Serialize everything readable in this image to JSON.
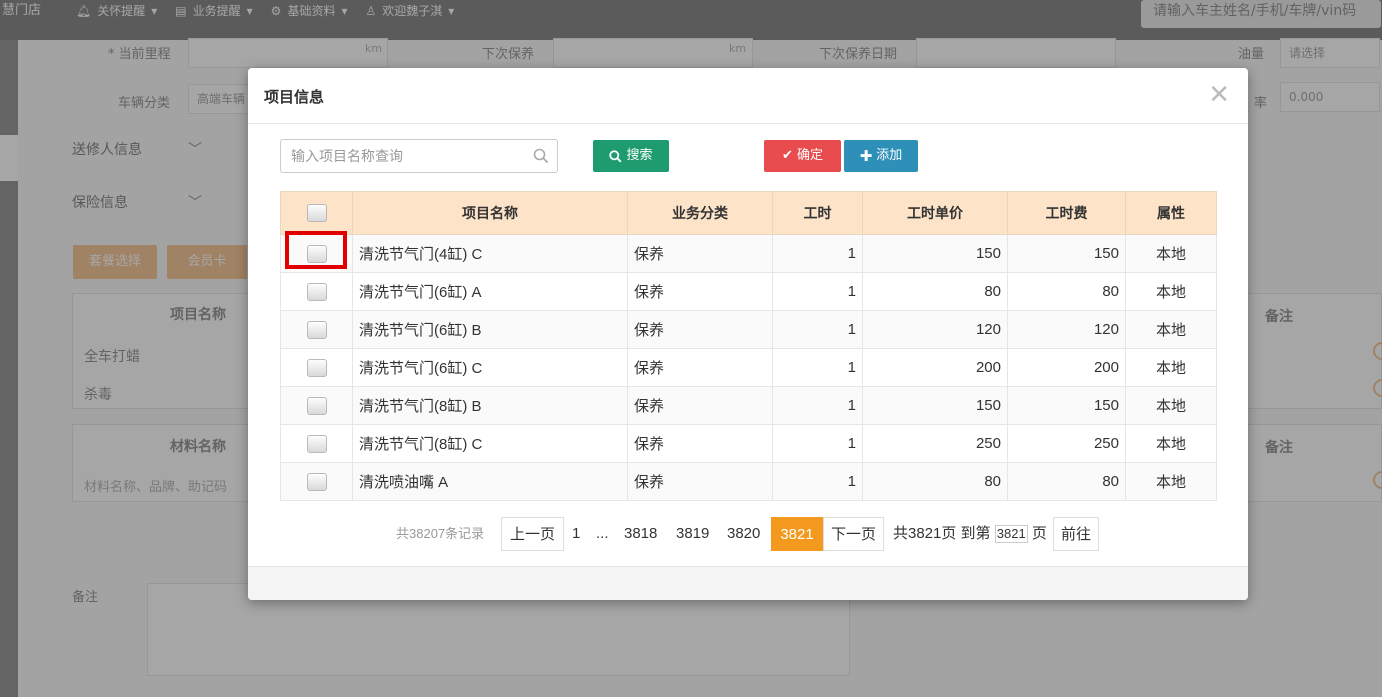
{
  "topbar": {
    "brand": "慧门店",
    "nav": [
      "关怀提醒",
      "业务提醒",
      "基础资料",
      "欢迎魏子淇"
    ],
    "search_placeholder": "请输入车主姓名/手机/车牌/vin码"
  },
  "background_form": {
    "mileage_label": "* 当前里程",
    "km1": "km",
    "next_service_label": "下次保养",
    "km2": "km",
    "next_service_date_label": "下次保养日期",
    "oil_label": "油量",
    "oil_value": "请选择",
    "vehicle_cat_label": "车辆分类",
    "vehicle_cat_value": "高端车辆",
    "rate_label": "率",
    "rate_value": "0.000",
    "sender_section": "送修人信息",
    "insurance_section": "保险信息",
    "package_btn": "套餐选择",
    "member_btn": "会员卡",
    "project_th": "项目名称",
    "remark_th1": "备注",
    "project_rows": [
      "全车打蜡",
      "杀毒"
    ],
    "material_th": "材料名称",
    "remark_th2": "备注",
    "material_placeholder": "材料名称、品牌、助记码",
    "remark_label": "备注"
  },
  "modal": {
    "title": "项目信息",
    "search_placeholder": "输入项目名称查询",
    "search_btn": "搜索",
    "confirm_btn": "确定",
    "add_btn": "添加",
    "columns": [
      "项目名称",
      "业务分类",
      "工时",
      "工时单价",
      "工时费",
      "属性"
    ],
    "rows": [
      {
        "name": "清洗节气门(4缸)  C",
        "cat": "保养",
        "hours": "1",
        "unit_price": "150",
        "fee": "150",
        "attr": "本地"
      },
      {
        "name": "清洗节气门(6缸)  A",
        "cat": "保养",
        "hours": "1",
        "unit_price": "80",
        "fee": "80",
        "attr": "本地"
      },
      {
        "name": "清洗节气门(6缸)  B",
        "cat": "保养",
        "hours": "1",
        "unit_price": "120",
        "fee": "120",
        "attr": "本地"
      },
      {
        "name": "清洗节气门(6缸)  C",
        "cat": "保养",
        "hours": "1",
        "unit_price": "200",
        "fee": "200",
        "attr": "本地"
      },
      {
        "name": "清洗节气门(8缸)  B",
        "cat": "保养",
        "hours": "1",
        "unit_price": "150",
        "fee": "150",
        "attr": "本地"
      },
      {
        "name": "清洗节气门(8缸)  C",
        "cat": "保养",
        "hours": "1",
        "unit_price": "250",
        "fee": "250",
        "attr": "本地"
      },
      {
        "name": "清洗喷油嘴 A",
        "cat": "保养",
        "hours": "1",
        "unit_price": "80",
        "fee": "80",
        "attr": "本地"
      }
    ],
    "pager": {
      "total": "共38207条记录",
      "prev": "上一页",
      "first": "1",
      "ellipsis": "...",
      "p1": "3818",
      "p2": "3819",
      "p3": "3820",
      "current": "3821",
      "next": "下一页",
      "summary": "共3821页 到第",
      "goto_value": "3821",
      "page_suffix": "页",
      "go": "前往"
    }
  },
  "colors": {
    "search_btn": "#1f9c6f",
    "confirm_btn": "#e84c4f",
    "add_btn": "#2e8fb8",
    "header_bg": "#fde3c8",
    "active_page": "#f39a1e",
    "highlight": "#e00000"
  }
}
